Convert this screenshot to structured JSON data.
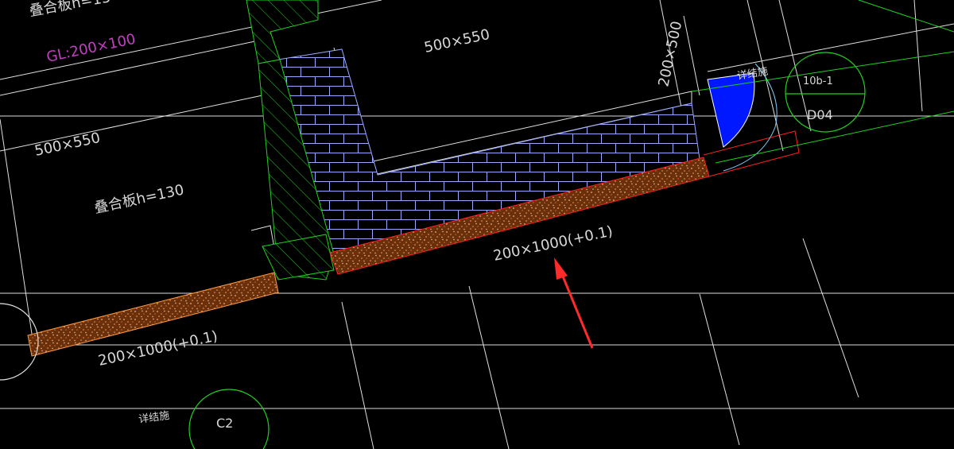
{
  "labels": {
    "top_slab": "叠合板h=13",
    "gl_beam": "GL:200×100",
    "beam_top": "500×550",
    "beam_right_vertical": "200×500",
    "beam_left": "500×550",
    "slab_left": "叠合板h=130",
    "beam_main": "200×1000(+0.1)",
    "beam_lower": "200×1000(+0.1)",
    "callout_right_id": "10b-1",
    "callout_right_ref": "D04",
    "callout_bottom_ref": "C2",
    "note_top": "详结施",
    "note_bottom": "详结施"
  },
  "colors": {
    "background": "#000000",
    "lines": "#e0e0e0",
    "beam_outline": "#ff2020",
    "beam_fill": "#7a3a10",
    "masonry": "#9aa8ff",
    "hatch": "#20d020",
    "circle": "#20d020",
    "door_fill": "#0018ff",
    "arrow": "#ff2a2a",
    "gl_text": "#c040c0"
  }
}
